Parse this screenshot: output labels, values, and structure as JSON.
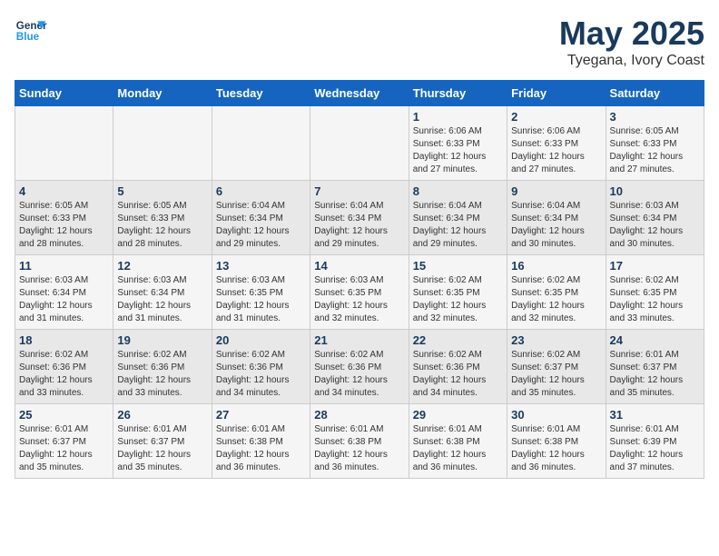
{
  "logo": {
    "line1": "General",
    "line2": "Blue"
  },
  "title": "May 2025",
  "subtitle": "Tyegana, Ivory Coast",
  "headers": [
    "Sunday",
    "Monday",
    "Tuesday",
    "Wednesday",
    "Thursday",
    "Friday",
    "Saturday"
  ],
  "weeks": [
    [
      {
        "day": "",
        "info": ""
      },
      {
        "day": "",
        "info": ""
      },
      {
        "day": "",
        "info": ""
      },
      {
        "day": "",
        "info": ""
      },
      {
        "day": "1",
        "info": "Sunrise: 6:06 AM\nSunset: 6:33 PM\nDaylight: 12 hours\nand 27 minutes."
      },
      {
        "day": "2",
        "info": "Sunrise: 6:06 AM\nSunset: 6:33 PM\nDaylight: 12 hours\nand 27 minutes."
      },
      {
        "day": "3",
        "info": "Sunrise: 6:05 AM\nSunset: 6:33 PM\nDaylight: 12 hours\nand 27 minutes."
      }
    ],
    [
      {
        "day": "4",
        "info": "Sunrise: 6:05 AM\nSunset: 6:33 PM\nDaylight: 12 hours\nand 28 minutes."
      },
      {
        "day": "5",
        "info": "Sunrise: 6:05 AM\nSunset: 6:33 PM\nDaylight: 12 hours\nand 28 minutes."
      },
      {
        "day": "6",
        "info": "Sunrise: 6:04 AM\nSunset: 6:34 PM\nDaylight: 12 hours\nand 29 minutes."
      },
      {
        "day": "7",
        "info": "Sunrise: 6:04 AM\nSunset: 6:34 PM\nDaylight: 12 hours\nand 29 minutes."
      },
      {
        "day": "8",
        "info": "Sunrise: 6:04 AM\nSunset: 6:34 PM\nDaylight: 12 hours\nand 29 minutes."
      },
      {
        "day": "9",
        "info": "Sunrise: 6:04 AM\nSunset: 6:34 PM\nDaylight: 12 hours\nand 30 minutes."
      },
      {
        "day": "10",
        "info": "Sunrise: 6:03 AM\nSunset: 6:34 PM\nDaylight: 12 hours\nand 30 minutes."
      }
    ],
    [
      {
        "day": "11",
        "info": "Sunrise: 6:03 AM\nSunset: 6:34 PM\nDaylight: 12 hours\nand 31 minutes."
      },
      {
        "day": "12",
        "info": "Sunrise: 6:03 AM\nSunset: 6:34 PM\nDaylight: 12 hours\nand 31 minutes."
      },
      {
        "day": "13",
        "info": "Sunrise: 6:03 AM\nSunset: 6:35 PM\nDaylight: 12 hours\nand 31 minutes."
      },
      {
        "day": "14",
        "info": "Sunrise: 6:03 AM\nSunset: 6:35 PM\nDaylight: 12 hours\nand 32 minutes."
      },
      {
        "day": "15",
        "info": "Sunrise: 6:02 AM\nSunset: 6:35 PM\nDaylight: 12 hours\nand 32 minutes."
      },
      {
        "day": "16",
        "info": "Sunrise: 6:02 AM\nSunset: 6:35 PM\nDaylight: 12 hours\nand 32 minutes."
      },
      {
        "day": "17",
        "info": "Sunrise: 6:02 AM\nSunset: 6:35 PM\nDaylight: 12 hours\nand 33 minutes."
      }
    ],
    [
      {
        "day": "18",
        "info": "Sunrise: 6:02 AM\nSunset: 6:36 PM\nDaylight: 12 hours\nand 33 minutes."
      },
      {
        "day": "19",
        "info": "Sunrise: 6:02 AM\nSunset: 6:36 PM\nDaylight: 12 hours\nand 33 minutes."
      },
      {
        "day": "20",
        "info": "Sunrise: 6:02 AM\nSunset: 6:36 PM\nDaylight: 12 hours\nand 34 minutes."
      },
      {
        "day": "21",
        "info": "Sunrise: 6:02 AM\nSunset: 6:36 PM\nDaylight: 12 hours\nand 34 minutes."
      },
      {
        "day": "22",
        "info": "Sunrise: 6:02 AM\nSunset: 6:36 PM\nDaylight: 12 hours\nand 34 minutes."
      },
      {
        "day": "23",
        "info": "Sunrise: 6:02 AM\nSunset: 6:37 PM\nDaylight: 12 hours\nand 35 minutes."
      },
      {
        "day": "24",
        "info": "Sunrise: 6:01 AM\nSunset: 6:37 PM\nDaylight: 12 hours\nand 35 minutes."
      }
    ],
    [
      {
        "day": "25",
        "info": "Sunrise: 6:01 AM\nSunset: 6:37 PM\nDaylight: 12 hours\nand 35 minutes."
      },
      {
        "day": "26",
        "info": "Sunrise: 6:01 AM\nSunset: 6:37 PM\nDaylight: 12 hours\nand 35 minutes."
      },
      {
        "day": "27",
        "info": "Sunrise: 6:01 AM\nSunset: 6:38 PM\nDaylight: 12 hours\nand 36 minutes."
      },
      {
        "day": "28",
        "info": "Sunrise: 6:01 AM\nSunset: 6:38 PM\nDaylight: 12 hours\nand 36 minutes."
      },
      {
        "day": "29",
        "info": "Sunrise: 6:01 AM\nSunset: 6:38 PM\nDaylight: 12 hours\nand 36 minutes."
      },
      {
        "day": "30",
        "info": "Sunrise: 6:01 AM\nSunset: 6:38 PM\nDaylight: 12 hours\nand 36 minutes."
      },
      {
        "day": "31",
        "info": "Sunrise: 6:01 AM\nSunset: 6:39 PM\nDaylight: 12 hours\nand 37 minutes."
      }
    ]
  ]
}
